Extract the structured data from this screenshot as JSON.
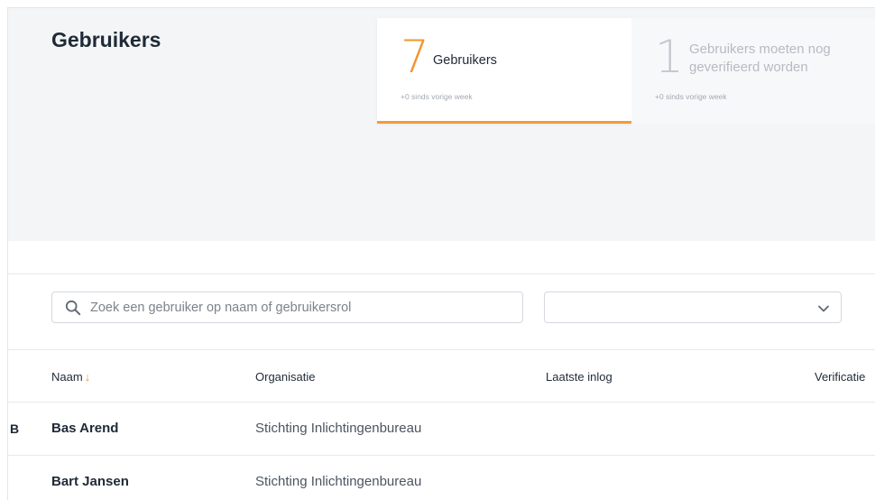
{
  "page": {
    "title": "Gebruikers"
  },
  "stats": [
    {
      "number": "7",
      "label": "Gebruikers",
      "sub": "+0 sinds vorige week",
      "active": true
    },
    {
      "number": "1",
      "label": "Gebruikers moeten nog geverifieerd worden",
      "sub": "+0 sinds vorige week",
      "active": false
    }
  ],
  "filters": {
    "search_placeholder": "Zoek een gebruiker op naam of gebruikersrol",
    "search_value": "",
    "dropdown_value": ""
  },
  "table": {
    "columns": [
      "Naam",
      "Organisatie",
      "Laatste inlog",
      "Verificatie"
    ],
    "sort_column": "Naam",
    "sort_arrow": "↓",
    "rows": [
      {
        "initial": "B",
        "name": "Bas Arend",
        "organisation": "Stichting Inlichtingenbureau"
      },
      {
        "initial": "",
        "name": "Bart Jansen",
        "organisation": "Stichting Inlichtingenbureau"
      }
    ]
  },
  "colors": {
    "accent": "#f2952d",
    "hero_bg": "#f4f5f7"
  }
}
